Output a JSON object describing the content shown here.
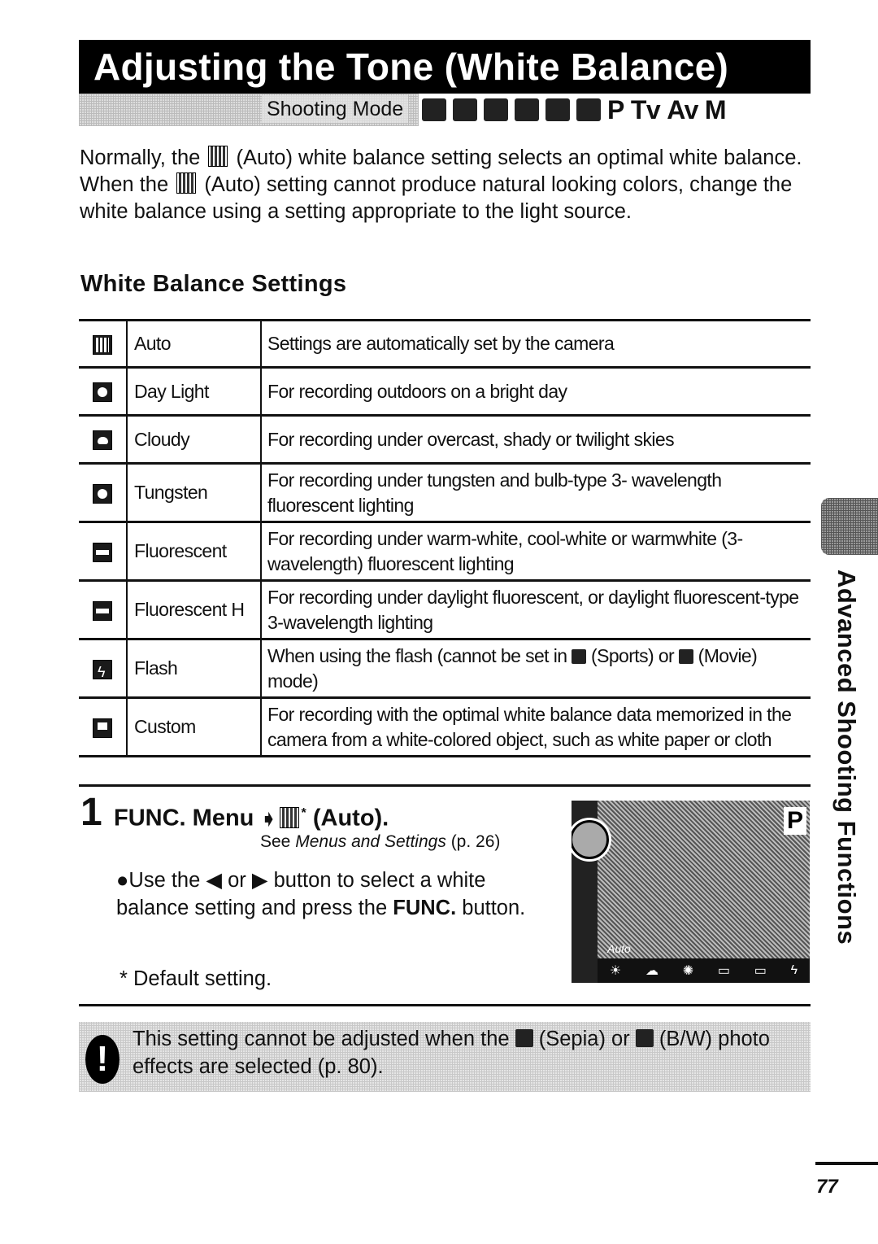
{
  "title": "Adjusting the Tone (White Balance)",
  "shooting_mode": {
    "label": "Shooting Mode",
    "icons": [
      "portrait-mode-icon",
      "landscape-mode-icon",
      "night-scene-icon",
      "sports-mode-icon",
      "stitch-assist-icon",
      "movie-mode-icon"
    ],
    "modes": [
      "P",
      "Tv",
      "Av",
      "M"
    ]
  },
  "intro": {
    "part1": "Normally, the",
    "part2": "(Auto) white balance setting selects an optimal white balance. When the",
    "part3": "(Auto) setting cannot produce natural looking colors, change the white balance using a setting appropriate to the light source."
  },
  "section_title": "White Balance Settings",
  "settings": [
    {
      "icon": "auto-wb-icon",
      "name": "Auto",
      "description": "Settings are automatically set by the camera"
    },
    {
      "icon": "daylight-wb-icon",
      "name": "Day Light",
      "description": "For recording outdoors on a bright day"
    },
    {
      "icon": "cloudy-wb-icon",
      "name": "Cloudy",
      "description": "For recording under overcast, shady or twilight skies"
    },
    {
      "icon": "tungsten-wb-icon",
      "name": "Tungsten",
      "description": "For recording under tungsten and bulb-type 3- wavelength fluorescent lighting"
    },
    {
      "icon": "fluorescent-wb-icon",
      "name": "Fluorescent",
      "description": "For recording under warm-white, cool-white or warmwhite (3-wavelength) fluorescent lighting"
    },
    {
      "icon": "fluorescent-h-wb-icon",
      "name": "Fluorescent H",
      "description": "For recording under daylight fluorescent, or daylight fluorescent-type 3-wavelength lighting"
    },
    {
      "icon": "flash-wb-icon",
      "name": "Flash",
      "description_parts": [
        "When using the flash (cannot be set in",
        "(Sports) or",
        "(Movie) mode)"
      ]
    },
    {
      "icon": "custom-wb-icon",
      "name": "Custom",
      "description": "For recording with the optimal white balance data memorized in the camera from a white-colored object, such as white paper or cloth"
    }
  ],
  "step": {
    "number": "1",
    "title_prefix": "FUNC. Menu",
    "arrow": "➧",
    "asterisk": "*",
    "title_suffix": "(Auto).",
    "ref_prefix": "See",
    "ref_italic": "Menus and Settings",
    "ref_page": "(p. 26)",
    "bullet_glyph": "●",
    "bullet_part1": "Use the",
    "left_arrow": "◀",
    "bullet_or": "or",
    "right_arrow": "▶",
    "bullet_part2": "button to select a white balance setting and press the",
    "bullet_bold": "FUNC.",
    "bullet_part3": "button.",
    "footnote": "* Default setting."
  },
  "lcd_screen": {
    "mode_letter": "P",
    "current_label": "Auto",
    "bottom_icons": [
      "☀",
      "☁",
      "✺",
      "▭",
      "▭",
      "ϟ"
    ]
  },
  "caution": {
    "icon": "!",
    "part1": "This setting cannot be adjusted when the",
    "part2": "(Sepia) or",
    "part3": "(B/W) photo effects are selected (p. 80)."
  },
  "side_tab": "Advanced Shooting Functions",
  "page_number": "77"
}
